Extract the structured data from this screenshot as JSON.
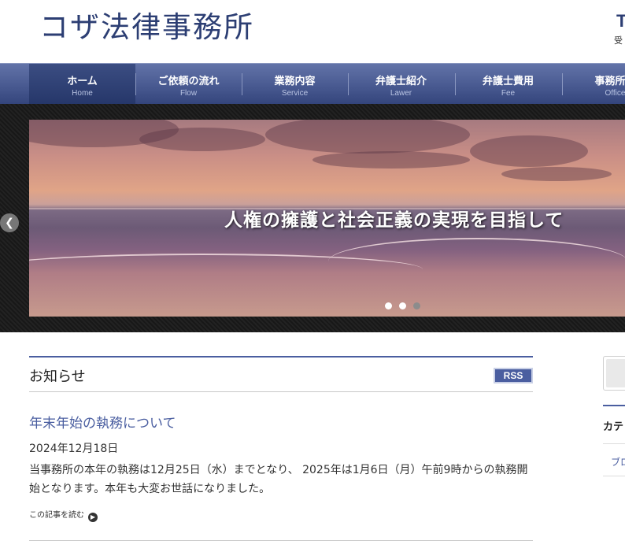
{
  "header": {
    "logo": "コザ法律事務所",
    "tel_fragment": "T",
    "reception_fragment": "受"
  },
  "nav": {
    "items": [
      {
        "label": "ホーム",
        "sub": "Home",
        "active": true
      },
      {
        "label": "ご依頼の流れ",
        "sub": "Flow",
        "active": false
      },
      {
        "label": "業務内容",
        "sub": "Service",
        "active": false
      },
      {
        "label": "弁護士紹介",
        "sub": "Lawer",
        "active": false
      },
      {
        "label": "弁護士費用",
        "sub": "Fee",
        "active": false
      },
      {
        "label": "事務所概",
        "sub": "Office",
        "active": false
      }
    ]
  },
  "slider": {
    "caption": "人権の擁護と社会正義の実現を目指して",
    "prev_icon": "chevron-left-icon",
    "dots": 3,
    "current_dot": 3
  },
  "news": {
    "heading": "お知らせ",
    "rss_label": "RSS",
    "article": {
      "title": "年末年始の執務について",
      "date": "2024年12月18日",
      "body": "当事務所の本年の執務は12月25日（水）までとなり、 2025年は1月6日（月）午前9時からの執務開始となります。本年も大変お世話になりました。",
      "read_more": "この記事を読む",
      "read_more_icon": "chevron-right-circle-icon"
    }
  },
  "sidebar": {
    "category_heading": "カテ",
    "category_link": "ブロ"
  },
  "colors": {
    "brand": "#2c3e73",
    "accent": "#4a5ea0",
    "nav_active": "#26376a"
  }
}
